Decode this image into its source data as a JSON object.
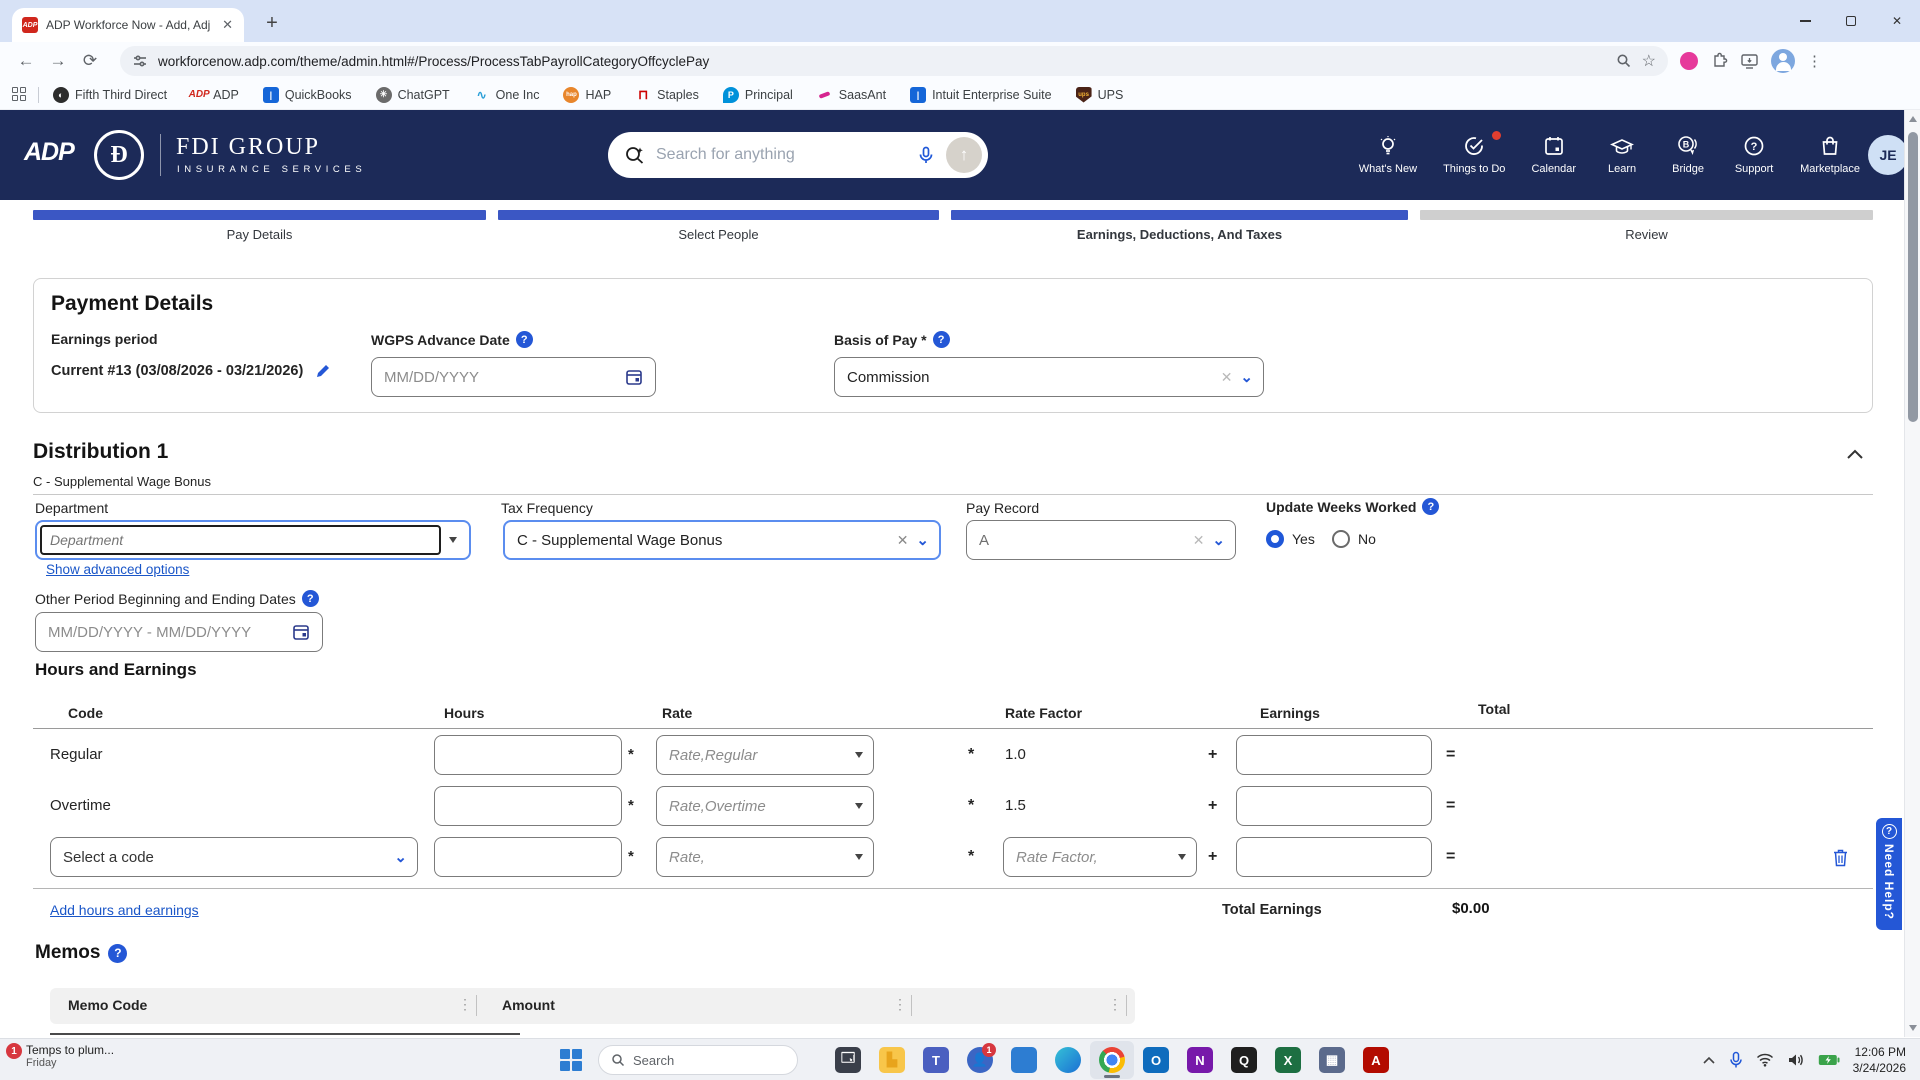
{
  "colors": {
    "navy": "#1c2a58",
    "accent_blue": "#2457d6",
    "bar_blue": "#3b57c4",
    "badge_red": "#d7373f",
    "link_blue": "#1a56c8"
  },
  "browser": {
    "tab_title": "ADP Workforce Now - Add, Adj",
    "url": "workforcenow.adp.com/theme/admin.html#/Process/ProcessTabPayrollCategoryOffcyclePay",
    "bookmarks": [
      {
        "label": "Fifth Third Direct"
      },
      {
        "label": "ADP"
      },
      {
        "label": "QuickBooks"
      },
      {
        "label": "ChatGPT"
      },
      {
        "label": "One Inc"
      },
      {
        "label": "HAP"
      },
      {
        "label": "Staples"
      },
      {
        "label": "Principal"
      },
      {
        "label": "SaasAnt"
      },
      {
        "label": "Intuit Enterprise Suite"
      },
      {
        "label": "UPS"
      }
    ]
  },
  "header": {
    "brand": "ADP",
    "logo_letter": "Ð",
    "company_name": "FDI GROUP",
    "company_tagline": "INSURANCE SERVICES",
    "search_placeholder": "Search for anything",
    "nav": [
      {
        "label": "What's New"
      },
      {
        "label": "Things to Do"
      },
      {
        "label": "Calendar"
      },
      {
        "label": "Learn"
      },
      {
        "label": "Bridge"
      },
      {
        "label": "Support"
      },
      {
        "label": "Marketplace"
      }
    ],
    "avatar_initials": "JE"
  },
  "stepper": {
    "steps": [
      {
        "label": "Pay Details"
      },
      {
        "label": "Select People"
      },
      {
        "label": "Earnings, Deductions, And Taxes"
      },
      {
        "label": "Review"
      }
    ]
  },
  "payment": {
    "title": "Payment Details",
    "earnings_period_label": "Earnings period",
    "earnings_period_value": "Current #13 (03/08/2026 - 03/21/2026)",
    "wgps_label": "WGPS Advance Date",
    "wgps_placeholder": "MM/DD/YYYY",
    "basis_label": "Basis of Pay *",
    "basis_value": "Commission"
  },
  "distribution": {
    "title": "Distribution 1",
    "subtitle": "C - Supplemental Wage Bonus",
    "department_label": "Department",
    "department_placeholder": "Department",
    "tax_frequency_label": "Tax Frequency",
    "tax_frequency_value": "C - Supplemental Wage Bonus",
    "pay_record_label": "Pay Record",
    "pay_record_value": "A",
    "update_weeks_label": "Update Weeks Worked",
    "yes_label": "Yes",
    "no_label": "No",
    "advanced_link": "Show advanced options",
    "other_period_label": "Other Period Beginning and Ending Dates",
    "other_period_placeholder": "MM/DD/YYYY - MM/DD/YYYY"
  },
  "hours": {
    "title": "Hours and Earnings",
    "columns": {
      "code": "Code",
      "hours": "Hours",
      "rate": "Rate",
      "rate_factor": "Rate Factor",
      "earnings": "Earnings",
      "total": "Total"
    },
    "rows": [
      {
        "code": "Regular",
        "rate_placeholder": "Rate,Regular",
        "rate_factor": "1.0"
      },
      {
        "code": "Overtime",
        "rate_placeholder": "Rate,Overtime",
        "rate_factor": "1.5"
      },
      {
        "code_placeholder": "Select a code",
        "rate_placeholder": "Rate,",
        "rate_factor_placeholder": "Rate Factor,"
      }
    ],
    "required_mark": "*",
    "op_multiply": "*",
    "op_plus": "+",
    "op_equals": "=",
    "add_link": "Add hours and earnings",
    "total_label": "Total Earnings",
    "total_value": "$0.00"
  },
  "memos": {
    "title": "Memos",
    "col_memo_code": "Memo Code",
    "col_amount": "Amount"
  },
  "need_help_label": "Need Help?",
  "taskbar": {
    "widget_badge": "1",
    "widget_line1": "Temps to plum...",
    "widget_line2": "Friday",
    "search_placeholder": "Search",
    "app_badge": "1",
    "time": "12:06 PM",
    "date": "3/24/2026"
  }
}
